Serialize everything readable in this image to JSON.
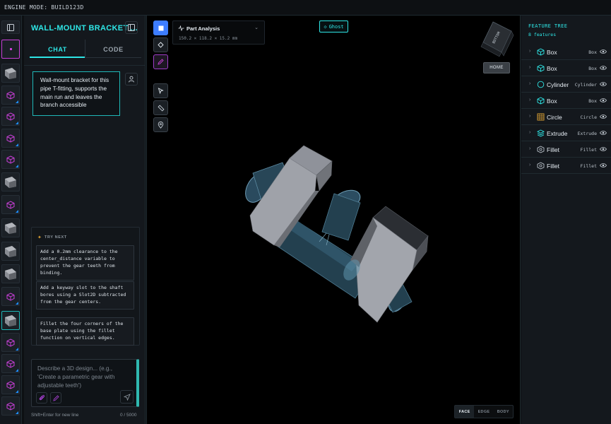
{
  "engine_label": "ENGINE MODE: BUILD123D",
  "thumbnails": [
    {
      "kind": "cube",
      "icon": "solid-preview-icon"
    },
    {
      "kind": "gray",
      "icon": "part-preview-icon"
    },
    {
      "kind": "cube",
      "icon": "cube-icon"
    },
    {
      "kind": "cube",
      "icon": "cube-icon"
    },
    {
      "kind": "cube",
      "icon": "cube-icon"
    },
    {
      "kind": "cube",
      "icon": "cube-icon"
    },
    {
      "kind": "gray",
      "icon": "part-preview-icon"
    },
    {
      "kind": "cube",
      "icon": "cube-icon"
    },
    {
      "kind": "gray",
      "icon": "part-preview-icon"
    },
    {
      "kind": "gray",
      "icon": "part-preview-icon"
    },
    {
      "kind": "gray",
      "icon": "part-preview-icon"
    },
    {
      "kind": "cube",
      "icon": "cube-icon"
    },
    {
      "kind": "gray",
      "icon": "part-preview-icon"
    },
    {
      "kind": "cube",
      "icon": "cube-icon"
    },
    {
      "kind": "cube",
      "icon": "cube-icon"
    },
    {
      "kind": "cube",
      "icon": "cube-icon"
    },
    {
      "kind": "cube",
      "icon": "cube-icon"
    }
  ],
  "chat": {
    "title": "WALL-MOUNT BRACKET ...",
    "tabs": [
      "CHAT",
      "CODE"
    ],
    "message": "Wall-mount bracket for this pipe T-fitting, supports the main run and leaves the branch accessible",
    "try_next_label": "TRY NEXT",
    "suggestions": [
      "Add a 0.2mm clearance to the center_distance variable to prevent the gear teeth from binding.",
      "Add a keyway slot to the shaft bores using a Slot2D subtracted from the gear centers.",
      "Fillet the four corners of the base plate using the fillet function on vertical edges."
    ],
    "composer_placeholder": "Describe a 3D design... (e.g., 'Create a parametric gear with adjustable teeth')",
    "hint": "Shift+Enter for new line",
    "char_count": "0 / 5000"
  },
  "viewport": {
    "analysis_title": "Part Analysis",
    "analysis_dims": "150.2 × 118.2 × 15.2 mm",
    "ghost_label": "Ghost",
    "home_label": "HOME",
    "view_cube_label": "BOTTOM",
    "select_modes": [
      "FACE",
      "EDGE",
      "BODY"
    ],
    "active_mode": "FACE"
  },
  "tree": {
    "title": "FEATURE TREE",
    "count": "8 features",
    "items": [
      {
        "name": "Box",
        "type": "Box",
        "icon": "cube-icon",
        "color": "#2ee6e6"
      },
      {
        "name": "Box",
        "type": "Box",
        "icon": "cube-icon",
        "color": "#2ee6e6"
      },
      {
        "name": "Cylinder",
        "type": "Cylinder",
        "icon": "circle-icon",
        "color": "#2ee6e6"
      },
      {
        "name": "Box",
        "type": "Box",
        "icon": "cube-icon",
        "color": "#2ee6e6"
      },
      {
        "name": "Circle",
        "type": "Circle",
        "icon": "grid-icon",
        "color": "#e3a635"
      },
      {
        "name": "Extrude",
        "type": "Extrude",
        "icon": "layers-icon",
        "color": "#2ee6e6"
      },
      {
        "name": "Fillet",
        "type": "Fillet",
        "icon": "gear-icon",
        "color": "#b9c1c9"
      },
      {
        "name": "Fillet",
        "type": "Fillet",
        "icon": "gear-icon",
        "color": "#b9c1c9"
      }
    ]
  },
  "colors": {
    "accent": "#2ee6e6",
    "cube_magenta": "#c83fd8",
    "primary_blue": "#3d7dff",
    "draw_purple": "#a13ecb"
  }
}
